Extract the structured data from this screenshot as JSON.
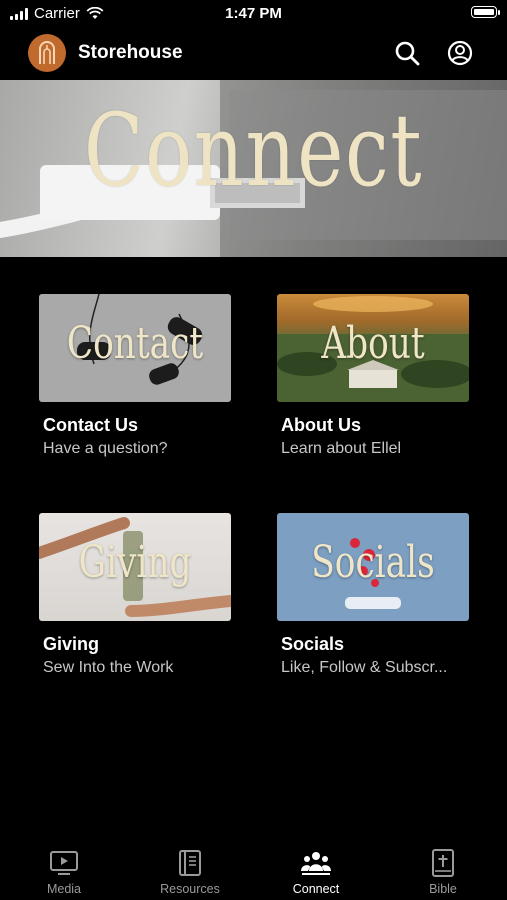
{
  "status": {
    "carrier": "Carrier",
    "time": "1:47 PM"
  },
  "header": {
    "app_name": "Storehouse"
  },
  "hero": {
    "title": "Connect"
  },
  "cards": [
    {
      "image_text": "Contact",
      "title": "Contact Us",
      "subtitle": "Have a question?"
    },
    {
      "image_text": "About",
      "title": "About Us",
      "subtitle": "Learn about Ellel"
    },
    {
      "image_text": "Giving",
      "title": "Giving",
      "subtitle": "Sew Into the Work"
    },
    {
      "image_text": "Socials",
      "title": "Socials",
      "subtitle": "Like, Follow & Subscr..."
    }
  ],
  "tabs": [
    {
      "label": "Media",
      "icon": "media-icon",
      "active": false
    },
    {
      "label": "Resources",
      "icon": "book-icon",
      "active": false
    },
    {
      "label": "Connect",
      "icon": "people-icon",
      "active": true
    },
    {
      "label": "Bible",
      "icon": "bible-icon",
      "active": false
    }
  ],
  "colors": {
    "logo_bg": "#c06a2d",
    "background": "#000000",
    "active_tab": "#ffffff",
    "inactive_tab": "#9a9a9a"
  }
}
